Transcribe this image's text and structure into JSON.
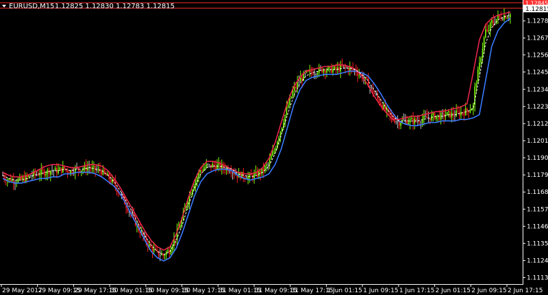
{
  "window": {
    "symbol_title": "EURUSD,M15",
    "ohlc": "1.12825 1.12830 1.12783 1.12815"
  },
  "price_labels": {
    "current": "1.12815",
    "ask": "1.12845"
  },
  "colors": {
    "background": "#000000",
    "axis": "#ffffff",
    "bull_candle": "#7fff00",
    "bear_candle": "#ff2020",
    "neutral_candle": "#c8c8c8",
    "upper_band": "#e8264a",
    "lower_band": "#3a7bff",
    "mid_line": "#ffffff",
    "price_line": "#ff3030",
    "current_label_bg": "#ffffff"
  },
  "chart_data": {
    "type": "line",
    "title": "EURUSD,M15",
    "y_range": [
      1.111,
      1.129
    ],
    "y_ticks": [
      "1.12783",
      "1.12673",
      "1.12565",
      "1.12455",
      "1.12343",
      "1.12233",
      "1.12123",
      "1.12013",
      "1.11903",
      "1.11793",
      "1.11683",
      "1.11573",
      "1.11463",
      "1.11353",
      "1.11243",
      "1.11133"
    ],
    "x_labels": [
      "29 May 2017",
      "29 May 09:15",
      "29 May 17:15",
      "30 May 01:15",
      "30 May 09:15",
      "30 May 17:15",
      "31 May 01:15",
      "31 May 09:15",
      "31 May 17:15",
      "1 Jun 01:15",
      "1 Jun 09:15",
      "1 Jun 17:15",
      "2 Jun 01:15",
      "2 Jun 09:15",
      "2 Jun 17:15"
    ],
    "series": [
      {
        "name": "",
        "values": [
          1.1177,
          1.1175,
          1.1174,
          1.1174,
          1.1175,
          1.1176,
          1.1177,
          1.1177,
          1.1178,
          1.1178,
          1.118,
          1.118,
          1.1181,
          1.1181,
          1.1181,
          1.118,
          1.1178,
          1.1175,
          1.1172,
          1.1167,
          1.116,
          1.1152,
          1.1145,
          1.1137,
          1.113,
          1.1126,
          1.1124,
          1.1126,
          1.1132,
          1.1142,
          1.1154,
          1.1166,
          1.1175,
          1.118,
          1.1182,
          1.1183,
          1.1183,
          1.1182,
          1.1179,
          1.1177,
          1.1176,
          1.1177,
          1.1178,
          1.118,
          1.1186,
          1.1196,
          1.121,
          1.1224,
          1.1234,
          1.124,
          1.1242,
          1.1243,
          1.1244,
          1.1244,
          1.1244,
          1.1245,
          1.1246,
          1.1246,
          1.1245,
          1.1243,
          1.1238,
          1.1232,
          1.1225,
          1.1219,
          1.1214,
          1.1212,
          1.1211,
          1.1211,
          1.1212,
          1.1213,
          1.1213,
          1.1214,
          1.1214,
          1.1214,
          1.1215,
          1.1215,
          1.1216,
          1.1218,
          1.124,
          1.1262,
          1.1272,
          1.1277,
          1.128
        ]
      },
      {
        "name": "",
        "values": [
          1.1181,
          1.1179,
          1.1178,
          1.1178,
          1.1179,
          1.1181,
          1.1183,
          1.1185,
          1.1186,
          1.1186,
          1.1185,
          1.1184,
          1.1184,
          1.1185,
          1.1186,
          1.1186,
          1.1185,
          1.1182,
          1.1177,
          1.1171,
          1.1164,
          1.1157,
          1.115,
          1.1143,
          1.1137,
          1.1133,
          1.1131,
          1.1133,
          1.1141,
          1.1152,
          1.1165,
          1.1176,
          1.1184,
          1.1188,
          1.1188,
          1.1187,
          1.1185,
          1.1183,
          1.1181,
          1.118,
          1.118,
          1.1181,
          1.1184,
          1.119,
          1.12,
          1.1213,
          1.1226,
          1.1236,
          1.1242,
          1.1246,
          1.1247,
          1.1248,
          1.1249,
          1.1249,
          1.125,
          1.125,
          1.1249,
          1.1247,
          1.1243,
          1.1237,
          1.123,
          1.1224,
          1.1219,
          1.1215,
          1.1215,
          1.1216,
          1.1217,
          1.1217,
          1.1218,
          1.1219,
          1.122,
          1.122,
          1.1221,
          1.1222,
          1.1223,
          1.1225,
          1.1245,
          1.1266,
          1.1276,
          1.128,
          1.1282,
          1.1283,
          1.1284
        ]
      },
      {
        "name": "",
        "values": [
          1.1179,
          1.1177,
          1.1176,
          1.1176,
          1.1177,
          1.1179,
          1.118,
          1.1181,
          1.1182,
          1.1182,
          1.1183,
          1.1182,
          1.1183,
          1.1183,
          1.1184,
          1.1183,
          1.1182,
          1.1179,
          1.1175,
          1.1169,
          1.1162,
          1.1155,
          1.1147,
          1.114,
          1.1134,
          1.113,
          1.1128,
          1.113,
          1.1137,
          1.1147,
          1.116,
          1.1171,
          1.118,
          1.1184,
          1.1185,
          1.1185,
          1.1184,
          1.1183,
          1.118,
          1.1179,
          1.1178,
          1.1179,
          1.1181,
          1.1185,
          1.1193,
          1.1205,
          1.1218,
          1.123,
          1.1238,
          1.1243,
          1.1245,
          1.1246,
          1.1247,
          1.1247,
          1.1247,
          1.1248,
          1.1248,
          1.1247,
          1.1244,
          1.124,
          1.1234,
          1.1228,
          1.1222,
          1.1217,
          1.1214,
          1.1214,
          1.1214,
          1.1214,
          1.1215,
          1.1216,
          1.1217,
          1.1217,
          1.1218,
          1.1218,
          1.1219,
          1.122,
          1.1222,
          1.1242,
          1.1264,
          1.1274,
          1.1279,
          1.1281,
          1.1282
        ]
      }
    ],
    "grid": false,
    "legend": "none"
  }
}
